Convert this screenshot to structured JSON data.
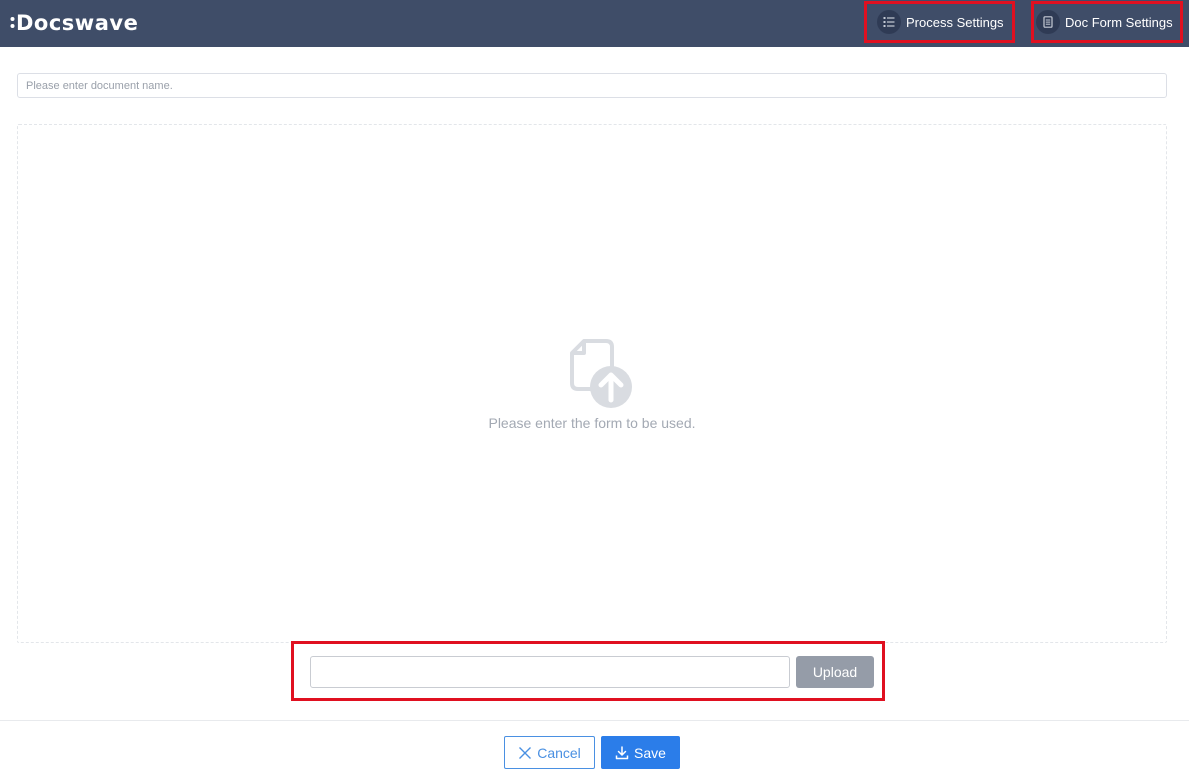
{
  "app": {
    "logo_text": "Docswave"
  },
  "header": {
    "process_settings_label": "Process Settings",
    "doc_form_settings_label": "Doc Form Settings"
  },
  "document": {
    "name_placeholder": "Please enter document name.",
    "name_value": ""
  },
  "dropzone": {
    "message": "Please enter the form to be used."
  },
  "upload": {
    "input_value": "",
    "button_label": "Upload"
  },
  "footer": {
    "cancel_label": "Cancel",
    "save_label": "Save"
  },
  "icons": {
    "process_settings": "list-icon",
    "doc_form_settings": "document-icon",
    "dropzone": "file-upload-icon",
    "cancel": "close-icon",
    "save": "download-icon"
  },
  "colors": {
    "header_bg": "#3f4d68",
    "highlight": "#e01020",
    "primary": "#2b7de9",
    "upload_button": "#959ca8"
  }
}
